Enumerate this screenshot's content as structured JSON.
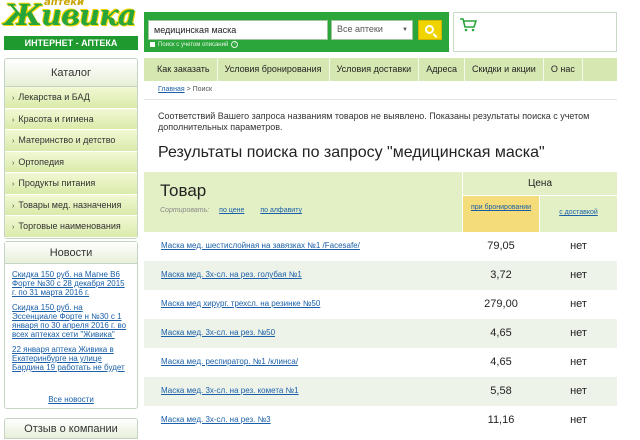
{
  "logo": {
    "brand": "Живика",
    "subtitle": "аптеки",
    "tagline": "ИНТЕРНЕТ - АПТЕКА"
  },
  "search": {
    "query": "медицинская маска",
    "pharmacy": "Все аптеки",
    "option_label": "Поиск с учетом описаний"
  },
  "sidebar": {
    "catalog_title": "Каталог",
    "items": [
      "Лекарства и БАД",
      "Красота и гигиена",
      "Материнство и детство",
      "Ортопедия",
      "Продукты питания",
      "Товары мед. назначения",
      "Торговые наименования"
    ],
    "news_title": "Новости",
    "news": [
      "Скидка 150 руб. на Магне В6 Форте №30 с 28 декабря 2015 г. по 31 марта 2016 г.",
      "Скидка 150 руб. на Эссенциале Форте н №30 с 1 января по 30 апреля 2016 г. во всех аптеках сети \"Живика\"",
      "22 января аптека Живика в Екатеринбурге на улице Бардина 19 работать не будет"
    ],
    "all_news": "Все новости",
    "about": "Отзыв о компании"
  },
  "nav": [
    "Как заказать",
    "Условия бронирования",
    "Условия доставки",
    "Адреса",
    "Скидки и акции",
    "О нас"
  ],
  "breadcrumb": {
    "home": "Главная",
    "sep": " > ",
    "current": "Поиск"
  },
  "notice": "Соответствий Вашего запроса названиям товаров не выявлено. Показаны результаты поиска с учетом дополнительных параметров.",
  "results_title": "Результаты поиска по запросу \"медицинская маска\"",
  "table": {
    "product_header": "Товар",
    "sort_label": "Сортировать:",
    "sort_by_price": "по цене",
    "sort_by_alpha": "по алфавиту",
    "price_header": "Цена",
    "price_reserve": "при бронировании",
    "price_delivery": "с доставкой",
    "rows": [
      {
        "name": "Маска мед. шестислойная на завязках №1 /Facesafe/",
        "price": "79,05",
        "delivery": "нет"
      },
      {
        "name": "Маска мед. 3х-сл. на рез. голубая №1",
        "price": "3,72",
        "delivery": "нет"
      },
      {
        "name": "Маска мед хирург. трехсл. на резинке №50",
        "price": "279,00",
        "delivery": "нет"
      },
      {
        "name": "Маска мед. 3х-сл. на рез. №50",
        "price": "4,65",
        "delivery": "нет"
      },
      {
        "name": "Маска мед. респиратор. №1 /клинса/",
        "price": "4,65",
        "delivery": "нет"
      },
      {
        "name": "Маска мед. 3х-сл. на рез. комета №1",
        "price": "5,58",
        "delivery": "нет"
      },
      {
        "name": "Маска мед. 3х-сл. на рез. №3",
        "price": "11,16",
        "delivery": "нет"
      }
    ]
  }
}
